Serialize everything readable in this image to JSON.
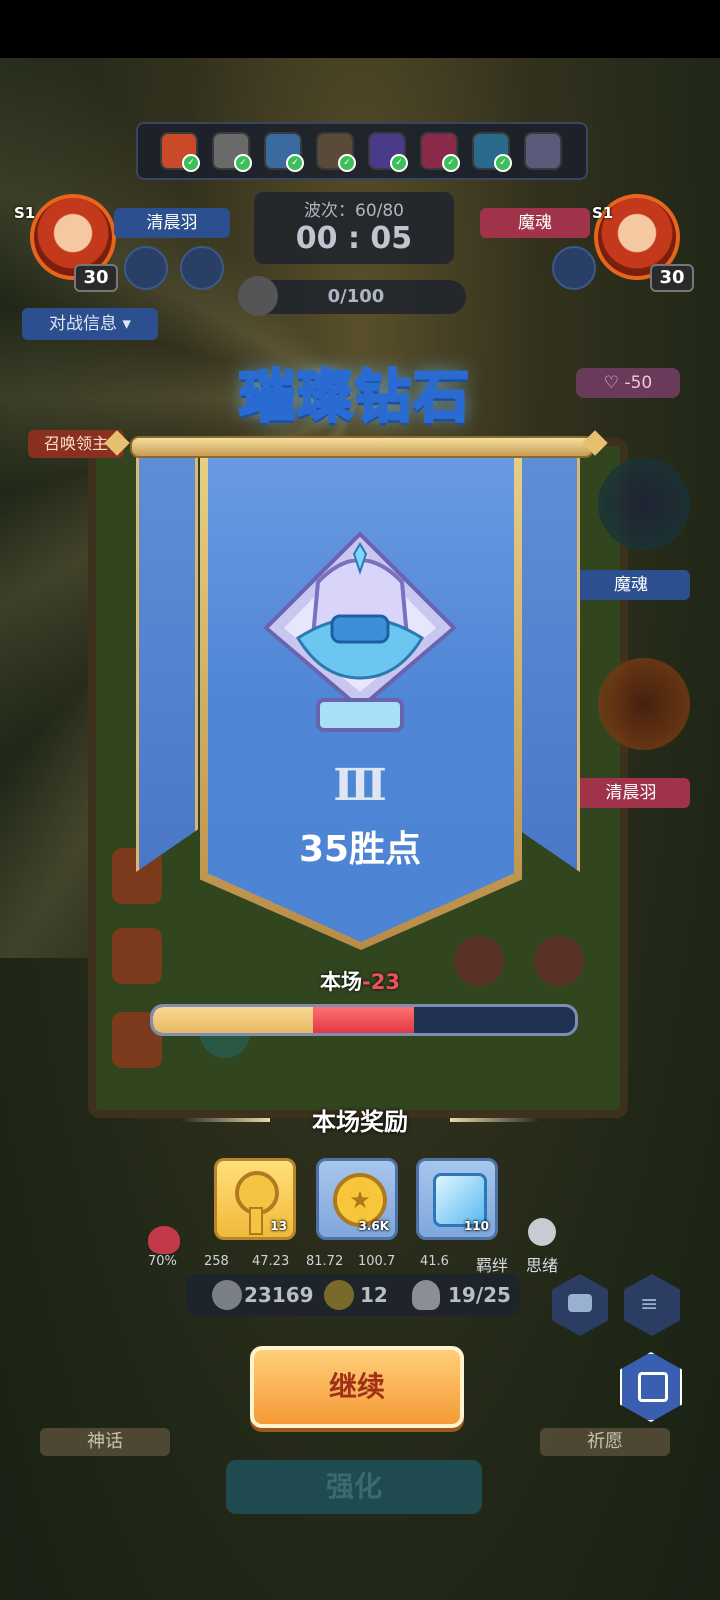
{
  "top_bar": {
    "player_left": {
      "season": "S1",
      "level": "30",
      "name": "清晨羽"
    },
    "player_right": {
      "season": "S1",
      "level": "30",
      "name": "魔魂"
    },
    "wave": "波次：60/80",
    "timer": "00 : 05",
    "kill_progress": "0/100",
    "battle_info": "对战信息"
  },
  "side_labels": {
    "summon_lord": "召唤领主",
    "heart_value": "-50",
    "boss_name_1": "魔魂",
    "boss_name_2": "清晨羽"
  },
  "rank": {
    "title": "璀璨钻石",
    "tier": "Ⅲ",
    "points": "35胜点"
  },
  "match": {
    "label": "本场",
    "delta": "-23",
    "progress_gold": 0.38,
    "progress_red": 0.24
  },
  "rewards": {
    "title": "本场奖励",
    "items": [
      {
        "icon": "key-icon",
        "count": "13"
      },
      {
        "icon": "coin-icon",
        "count": "3.6K"
      },
      {
        "icon": "ice-cube-icon",
        "count": "110"
      }
    ]
  },
  "stats": {
    "row": [
      "70%",
      "258",
      "47.23",
      "81.72",
      "100.7",
      "41.6"
    ],
    "fetter": "羁绊",
    "thought": "思绪",
    "silver": "23169",
    "clover": "12",
    "units": "19/25"
  },
  "buttons": {
    "continue": "继续",
    "myth": "神话",
    "wish": "祈愿",
    "upgrade": "强化"
  },
  "colors": {
    "banner_blue": "#5086d6",
    "gold": "#f0c36a",
    "red": "#f0505a",
    "continue_orange": "#f5a23c"
  }
}
